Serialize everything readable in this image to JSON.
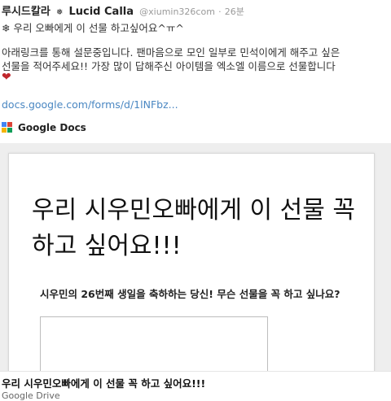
{
  "tweet": {
    "display_name": "루시드칼라",
    "name_separator": "❅",
    "name_latin": "Lucid Calla",
    "handle": "@xiumin326com",
    "dot": "·",
    "time": "26분",
    "line1": "❄ 우리 오빠에게 이 선물 하고싶어요^ㅠ^",
    "line2": "아래링크를 통해 설문중입니다. 팬마음으로 모인 일부로 민석이에게 해주고 싶은",
    "line3": "선물을 적어주세요!! 가장 많이 답해주신 아이템을 엑소엘 이름으로 선물합니다",
    "heart": "❤",
    "link_text": "docs.google.com/forms/d/1lNFbz..."
  },
  "card": {
    "source_label": "Google Docs",
    "form_title": "우리 시우민오빠에게 이 선물 꼭 하고 싶어요!!!",
    "question": "시우민의 26번째 생일을 축하하는 당신! 무슨 선물을 꼭 하고 싶나요?",
    "title": "우리 시우민오빠에게 이 선물 꼭 하고 싶어요!!!",
    "subtitle": "Google Drive"
  },
  "colors": {
    "link": "#4a87c2",
    "heart": "#c0272d",
    "google_blue": "#4285f4",
    "google_red": "#db4437",
    "google_yellow": "#f4b400",
    "google_green": "#0f9d58"
  }
}
